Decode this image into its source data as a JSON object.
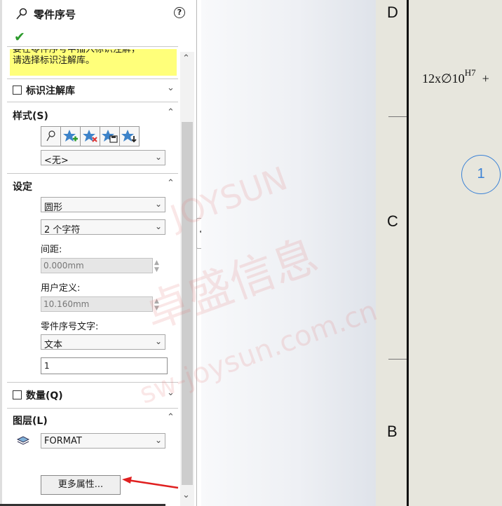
{
  "panel": {
    "title": "零件序号",
    "help": "?",
    "ok": "✔",
    "message_line1": "要在零件序号中插入标识注解，",
    "message_line2": "请选择标识注解库。"
  },
  "sections": {
    "annotation_library": "标识注解库",
    "style": "样式(S)",
    "settings": "设定",
    "quantity": "数量(Q)",
    "layer": "图层(L)"
  },
  "style": {
    "value": "<无>"
  },
  "settings": {
    "shape": "圆形",
    "size": "2 个字符",
    "spacing_label": "间距:",
    "spacing_value": "0.000mm",
    "custom_label": "用户定义:",
    "custom_value": "10.160mm",
    "text_label": "零件序号文字:",
    "text_type": "文本",
    "text_value": "1"
  },
  "layer": {
    "value": "FORMAT"
  },
  "more_button": "更多属性...",
  "drawing": {
    "zone_d": "D",
    "zone_c": "C",
    "zone_b": "B",
    "dimension": "12x∅10",
    "tolerance": "H7",
    "plus": "+",
    "balloon_number": "1"
  },
  "watermark": {
    "brand": "JOYSUN",
    "company": "卓盛信息",
    "url": "sw-joysun.com.cn"
  },
  "colors": {
    "accent": "#3b82d6",
    "message_bg": "#ffff7a",
    "arrow": "#e02020",
    "ok": "#2b9a2b"
  }
}
